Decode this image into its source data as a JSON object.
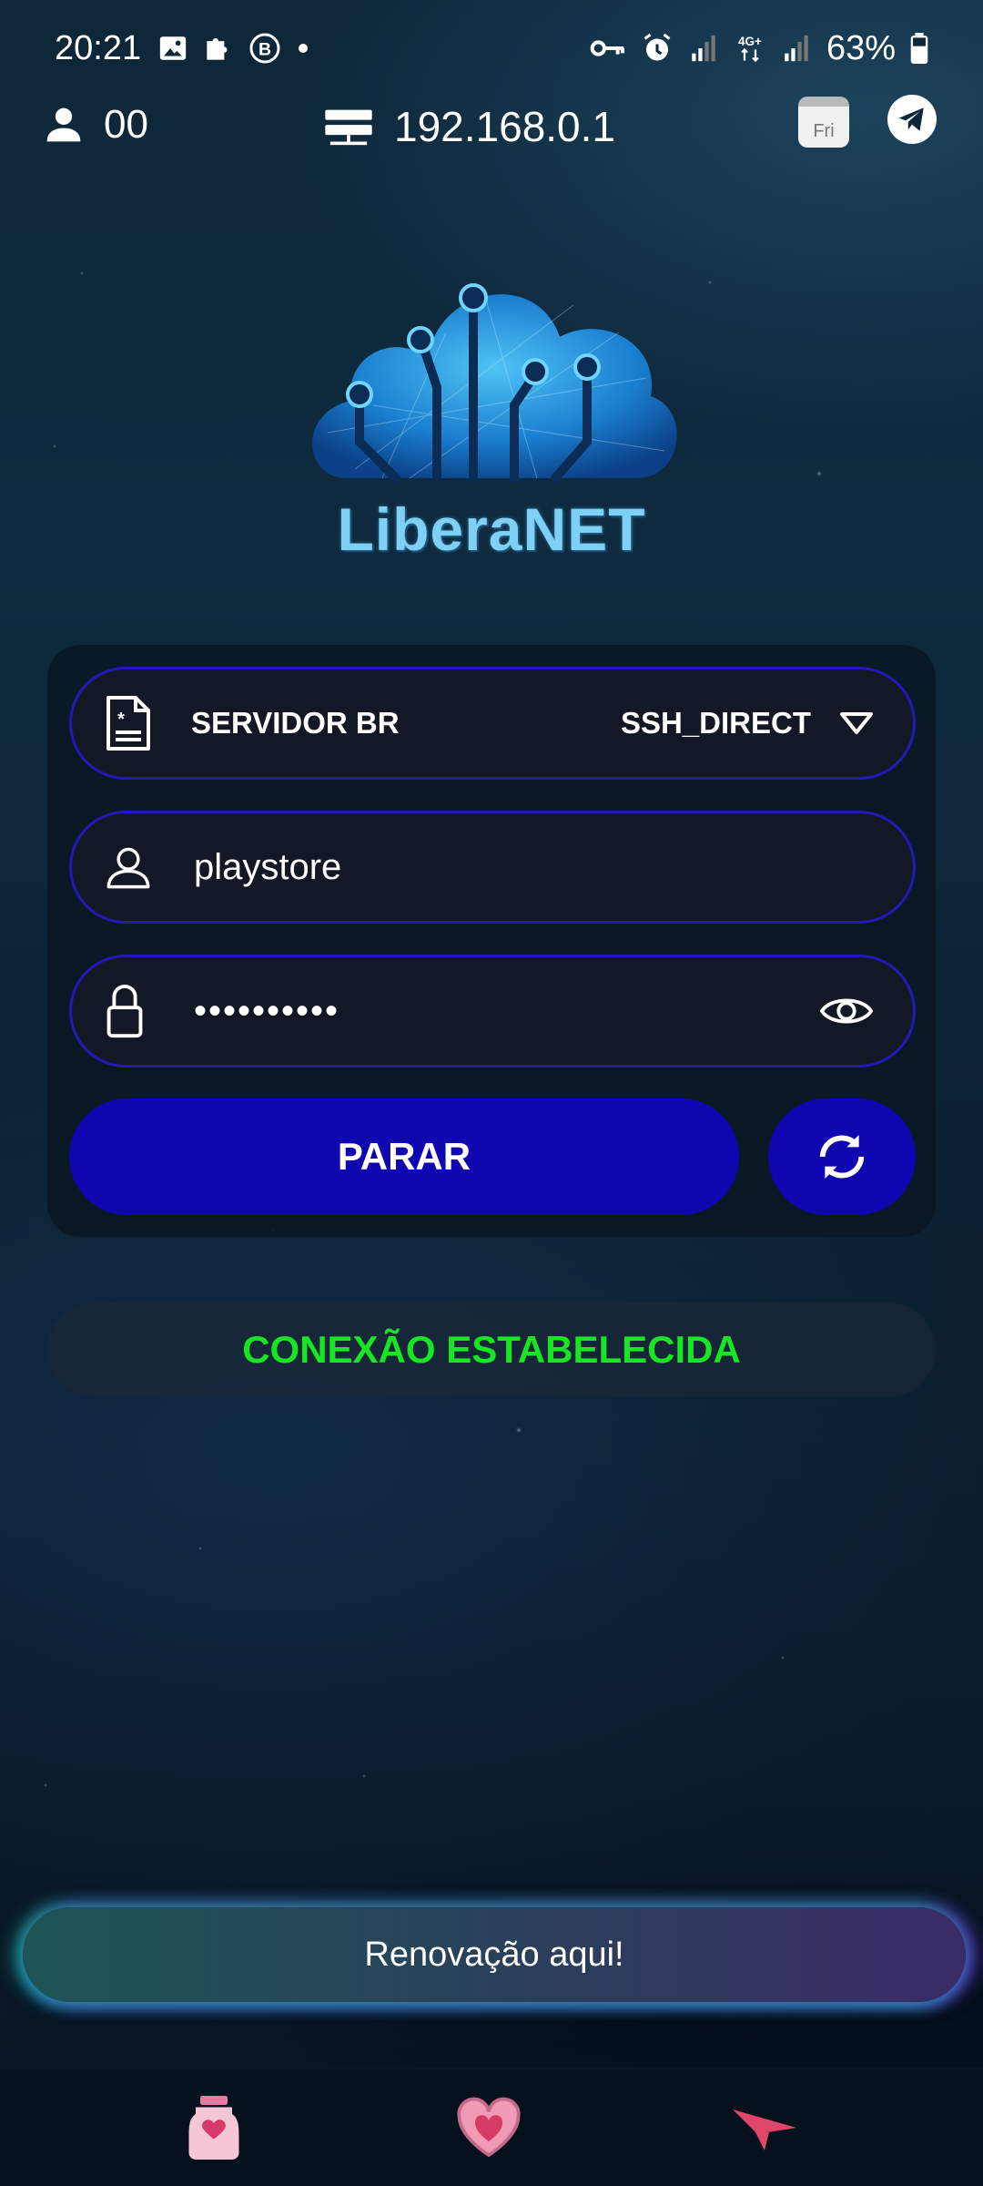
{
  "status_bar": {
    "time": "20:21",
    "network": "4G+",
    "battery": "63%"
  },
  "top_bar": {
    "user_count": "00",
    "ip_address": "192.168.0.1",
    "calendar_day": "Fri"
  },
  "logo": {
    "text": "LiberaNET"
  },
  "form": {
    "server_name": "SERVIDOR BR",
    "server_type": "SSH_DIRECT",
    "username": "playstore",
    "password_masked": "••••••••••"
  },
  "buttons": {
    "stop_label": "PARAR",
    "renew_label": "Renovação aqui!"
  },
  "connection_status": "CONEXÃO ESTABELECIDA",
  "colors": {
    "primary_button": "#0f06b1",
    "field_border": "#2418b8",
    "status_text": "#18e623"
  },
  "bottom_nav": [
    {
      "icon": "jar-icon"
    },
    {
      "icon": "heart-icon"
    },
    {
      "icon": "paper-plane-icon"
    }
  ]
}
